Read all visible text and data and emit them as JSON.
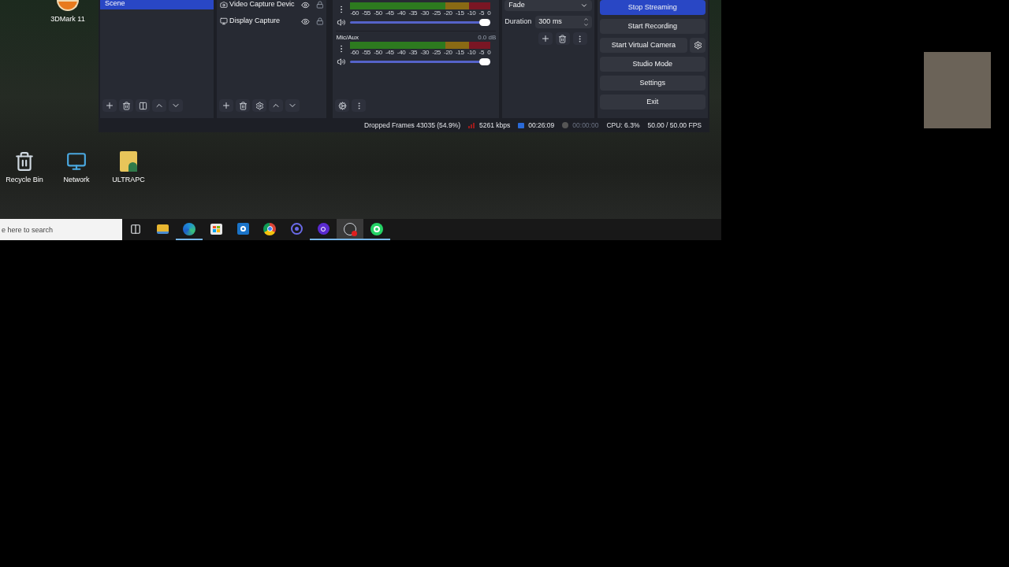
{
  "desktop_top_icons": [
    {
      "label": "3DMark 11",
      "kind": "app"
    }
  ],
  "obs": {
    "scenes": [
      {
        "label": "Scene",
        "selected": true
      }
    ],
    "sources": [
      {
        "label": "Video Capture Devic",
        "kind": "camera"
      },
      {
        "label": "Display Capture",
        "kind": "display"
      }
    ],
    "mixer": {
      "channels": [
        {
          "scale": [
            "-60",
            "-55",
            "-50",
            "-45",
            "-40",
            "-35",
            "-30",
            "-25",
            "-20",
            "-15",
            "-10",
            "-5",
            "0"
          ],
          "level": 1.0
        },
        {
          "name": "Mic/Aux",
          "reading": "0.0 dB",
          "scale": [
            "-60",
            "-55",
            "-50",
            "-45",
            "-40",
            "-35",
            "-30",
            "-25",
            "-20",
            "-15",
            "-10",
            "-5",
            "0"
          ],
          "level": 1.0
        }
      ]
    },
    "transitions": {
      "type": "Fade",
      "duration_label": "Duration",
      "duration": "300 ms"
    },
    "controls": [
      {
        "label": "Stop Streaming",
        "selected": true,
        "kind": "plain"
      },
      {
        "label": "Start Recording",
        "selected": false,
        "kind": "plain"
      },
      {
        "label": "Start Virtual Camera",
        "selected": false,
        "kind": "with-settings"
      },
      {
        "label": "Studio Mode",
        "selected": false,
        "kind": "plain"
      },
      {
        "label": "Settings",
        "selected": false,
        "kind": "plain"
      },
      {
        "label": "Exit",
        "selected": false,
        "kind": "plain"
      }
    ],
    "status_bar": [
      {
        "kind": "text",
        "text": "Dropped Frames 43035 (54.9%)"
      },
      {
        "kind": "bitrate",
        "text": "5261 kbps"
      },
      {
        "kind": "stream-time",
        "text": "00:26:09"
      },
      {
        "kind": "record-time",
        "text": "00:00:00"
      },
      {
        "kind": "text",
        "text": "CPU: 6.3%"
      },
      {
        "kind": "text",
        "text": "50.00 / 50.00 FPS"
      }
    ]
  },
  "desktop_icons": [
    {
      "label": "Recycle Bin",
      "kind": "bin"
    },
    {
      "label": "Network",
      "kind": "network"
    },
    {
      "label": "ULTRAPC",
      "kind": "user-folder"
    }
  ],
  "taskbar": {
    "search": {
      "placeholder": "e here to search"
    },
    "apps": [
      {
        "kind": "task-view",
        "running": false,
        "selected": false
      },
      {
        "kind": "folder",
        "running": false,
        "selected": false
      },
      {
        "kind": "browser-wave",
        "running": true,
        "selected": false
      },
      {
        "kind": "store",
        "running": false,
        "selected": false
      },
      {
        "kind": "mail",
        "running": false,
        "selected": false
      },
      {
        "kind": "browser-ring",
        "running": false,
        "selected": false
      },
      {
        "kind": "swirl",
        "running": false,
        "selected": false
      },
      {
        "kind": "dot-ring",
        "running": true,
        "selected": false
      },
      {
        "kind": "record-app",
        "running": true,
        "selected": true
      },
      {
        "kind": "chat",
        "running": true,
        "selected": false
      }
    ]
  },
  "webcam": {
    "kind": "photo"
  }
}
